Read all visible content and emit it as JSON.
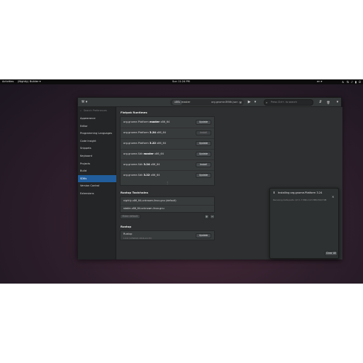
{
  "topbar": {
    "activities": "Activities",
    "app_menu": "(Nightly) Builder ▾",
    "clock": "Sun 11:24 PM",
    "language": "en ▾",
    "tray_icons": [
      "accessibility-icon",
      "network-icon",
      "volume-icon",
      "battery-icon",
      "power-icon"
    ]
  },
  "header": {
    "tools_menu_glyph": "⚒ ▾",
    "build_target": {
      "label": "x86s",
      "branch": "master",
      "manifest": "org.gnome.Bfilth.json",
      "build_icon_glyph": "⚒"
    },
    "run_glyph": "▶",
    "run_menu_glyph": "▾",
    "search": {
      "placeholder": "Press Ctrl+. to search",
      "icon_glyph": "⌕"
    },
    "panel_toggle_glyph": "⇵",
    "trash_glyph": "🗑",
    "menu_glyph": "▾"
  },
  "sidebar": {
    "search_placeholder": "Search Preferences",
    "search_icon_glyph": "⌕",
    "items": [
      {
        "label": "Appearance"
      },
      {
        "label": "Editor"
      },
      {
        "label": "Programming Languages"
      },
      {
        "label": "Code Insight"
      },
      {
        "label": "Snippets"
      },
      {
        "label": "Keyboard"
      },
      {
        "label": "Projects"
      },
      {
        "label": "Build"
      },
      {
        "label": "SDKs",
        "selected": true
      },
      {
        "label": "Version Control"
      },
      {
        "label": "Extensions"
      }
    ]
  },
  "flatpak": {
    "title": "Flatpak Runtimes",
    "runtimes": [
      {
        "prefix": "org.gnome.Platform ",
        "version": "master",
        "suffix": " x86_64",
        "action": "Update",
        "enabled": true
      },
      {
        "prefix": "org.gnome.Platform ",
        "version": "3.24",
        "suffix": " x86_64",
        "action": "Install",
        "enabled": false
      },
      {
        "prefix": "org.gnome.Platform ",
        "version": "3.22",
        "suffix": " x86_64",
        "action": "Update",
        "enabled": true
      },
      {
        "prefix": "org.gnome.Sdk ",
        "version": "master",
        "suffix": " x86_64",
        "action": "Update",
        "enabled": true
      },
      {
        "prefix": "org.gnome.Sdk ",
        "version": "3.24",
        "suffix": " x86_64",
        "action": "Install",
        "enabled": true
      },
      {
        "prefix": "org.gnome.Sdk ",
        "version": "3.22",
        "suffix": " x86_64",
        "action": "Update",
        "enabled": true
      }
    ],
    "more_glyph": "⋮"
  },
  "toolchains": {
    "title": "Rustup Toolchains",
    "items": [
      {
        "label": "nightly-x86_64-unknown-linux-gnu (default)"
      },
      {
        "label": "stable-x86_64-unknown-linux-gnu"
      }
    ],
    "make_default": "Make default",
    "add_glyph": "+",
    "remove_glyph": "−"
  },
  "rustup": {
    "title": "Rustup",
    "name": "Rustup",
    "version": "1.0.0 (17b6d21 2016-12-15)",
    "action": "Update"
  },
  "popover": {
    "title": "Installing org.gnome.Platform 3.24",
    "status": "Receiving delta parts: 2/3 1.7 MB/s 10.5 MB/156.8 MB",
    "icon_glyph": "⬇",
    "close_glyph": "×",
    "clear_all": "Clear All"
  }
}
